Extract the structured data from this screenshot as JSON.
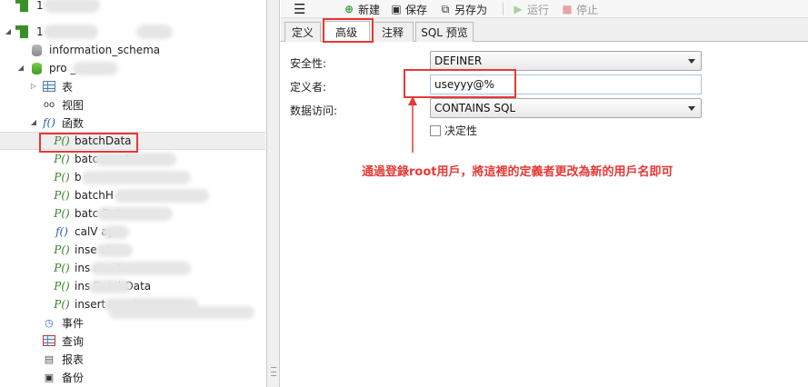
{
  "tree": {
    "items": [
      {
        "label": "information_schema"
      },
      {
        "label": "pro          _   w"
      },
      {
        "label": "表"
      },
      {
        "label": "视图"
      },
      {
        "label": "函数"
      },
      {
        "label": "batchData"
      },
      {
        "label": "batc                    ment"
      },
      {
        "label": "b"
      },
      {
        "label": "batchH"
      },
      {
        "label": "batc                    Data"
      },
      {
        "label": "calV          ay"
      },
      {
        "label": "inse         ata"
      },
      {
        "label": "ins                           ment"
      },
      {
        "label": "ins        BatchData"
      },
      {
        "label": "insert                         ment"
      },
      {
        "label": "事件"
      },
      {
        "label": "查询"
      },
      {
        "label": "报表"
      },
      {
        "label": "备份"
      }
    ],
    "top_rows": [
      {
        "label": "1"
      },
      {
        "label": "1        st              w"
      }
    ]
  },
  "toolbar": {
    "menu_icon": "hamburger-icon",
    "new_label": "新建",
    "save_label": "保存",
    "saveas_label": "另存为",
    "run_label": "运行",
    "stop_label": "停止"
  },
  "tabs": [
    {
      "label": "定义"
    },
    {
      "label": "高级"
    },
    {
      "label": "注释"
    },
    {
      "label": "SQL 预览"
    }
  ],
  "form": {
    "security_label": "安全性:",
    "security_value": "DEFINER",
    "definer_label": "定义者:",
    "definer_value": "useyyy@%",
    "data_access_label": "数据访问:",
    "data_access_value": "CONTAINS SQL",
    "deterministic_label": "决定性"
  },
  "annotation": {
    "note": "通過登錄root用戶，將這裡的定義者更改為新的用戶名即可",
    "color": "#e53935"
  }
}
